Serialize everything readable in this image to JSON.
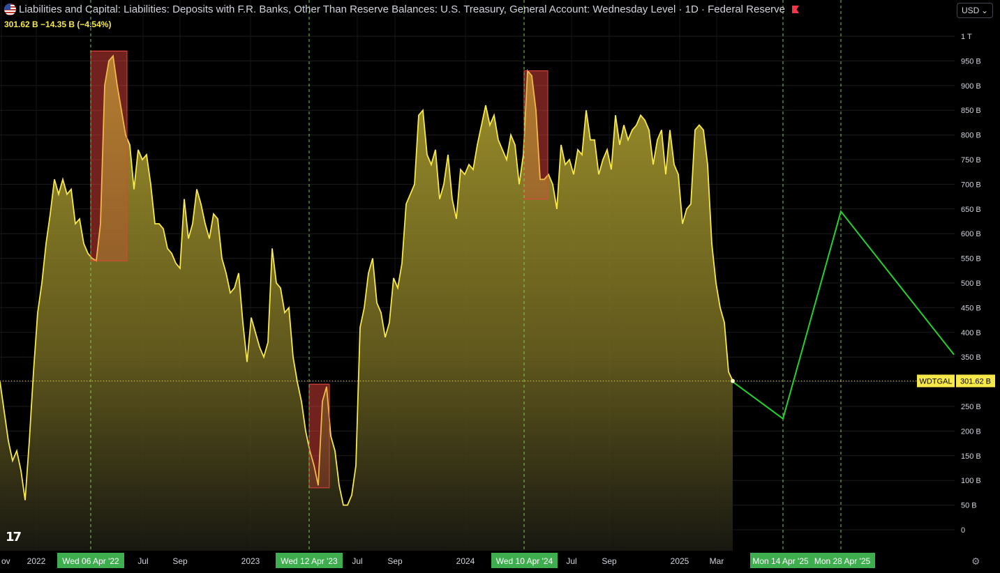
{
  "header": {
    "title": "Liabilities and Capital: Liabilities: Deposits with F.R. Banks, Other Than Reserve Balances: U.S. Treasury, General Account: Wednesday Level · 1D · Federal Reserve",
    "value_line": "301.62 B  −14.35 B (−4.54%)"
  },
  "currency": "USD",
  "price_tag": {
    "symbol": "WDTGAL",
    "value": "301.62 B"
  },
  "colors": {
    "series": "#f7e84a",
    "projection": "#22d42a",
    "highlight": "#e0443c",
    "date_tag": "#3fae4f"
  },
  "chart_data": {
    "type": "area",
    "y_unit": "billions USD",
    "ylim": [
      0,
      1000
    ],
    "y_ticks": [
      "1 T",
      "950 B",
      "900 B",
      "850 B",
      "800 B",
      "750 B",
      "700 B",
      "650 B",
      "600 B",
      "550 B",
      "500 B",
      "450 B",
      "400 B",
      "350 B",
      "300 B",
      "250 B",
      "200 B",
      "150 B",
      "100 B",
      "50 B",
      "0"
    ],
    "x_ticks": [
      "ov",
      "2022",
      "Jul",
      "Sep",
      "2023",
      "Jul",
      "Sep",
      "2024",
      "Jul",
      "Sep",
      "2025",
      "Mar"
    ],
    "date_labels": [
      "Wed 06 Apr '22",
      "Wed 12 Apr '23",
      "Wed 10 Apr '24",
      "Mon 14 Apr '25",
      "Mon 28 Apr '25"
    ],
    "series": [
      {
        "values": [
          300,
          240,
          180,
          140,
          160,
          120,
          60,
          180,
          320,
          440,
          500,
          580,
          640,
          710,
          680,
          710,
          680,
          690,
          620,
          630,
          580,
          560,
          550,
          545,
          620,
          900,
          950,
          960,
          900,
          850,
          800,
          780,
          690,
          770,
          750,
          760,
          700,
          620,
          620,
          610,
          570,
          560,
          540,
          530,
          670,
          590,
          620,
          690,
          660,
          620,
          590,
          640,
          630,
          550,
          520,
          480,
          490,
          520,
          420,
          340,
          430,
          400,
          370,
          350,
          380,
          570,
          500,
          490,
          440,
          450,
          350,
          300,
          260,
          200,
          160,
          130,
          90,
          260,
          290,
          190,
          160,
          90,
          50,
          50,
          70,
          130,
          410,
          450,
          520,
          550,
          460,
          440,
          390,
          420,
          510,
          490,
          540,
          660,
          680,
          700,
          840,
          850,
          760,
          740,
          770,
          670,
          700,
          760,
          670,
          630,
          730,
          720,
          740,
          730,
          780,
          820,
          860,
          820,
          840,
          790,
          770,
          750,
          800,
          780,
          700,
          760,
          930,
          920,
          850,
          710,
          710,
          720,
          700,
          650,
          780,
          740,
          750,
          720,
          770,
          760,
          850,
          790,
          790,
          720,
          750,
          770,
          730,
          840,
          780,
          820,
          790,
          810,
          820,
          840,
          830,
          810,
          740,
          790,
          810,
          720,
          810,
          740,
          720,
          620,
          650,
          660,
          810,
          820,
          810,
          740,
          580,
          500,
          450,
          420,
          320,
          302
        ]
      },
      {
        "name": "WDTGAL projection",
        "points": [
          [
            302,
            "Mar '25"
          ],
          [
            225,
            "Mon 14 Apr '25"
          ],
          [
            645,
            "Mon 28 Apr '25"
          ],
          [
            355,
            "May '25"
          ]
        ]
      }
    ],
    "highlights": [
      {
        "label": "Wed 06 Apr '22",
        "range_low": 545,
        "range_high": 970
      },
      {
        "label": "Wed 12 Apr '23",
        "range_low": 85,
        "range_high": 295
      },
      {
        "label": "Wed 10 Apr '24",
        "range_low": 670,
        "range_high": 930
      }
    ],
    "last_value": 301.62
  }
}
